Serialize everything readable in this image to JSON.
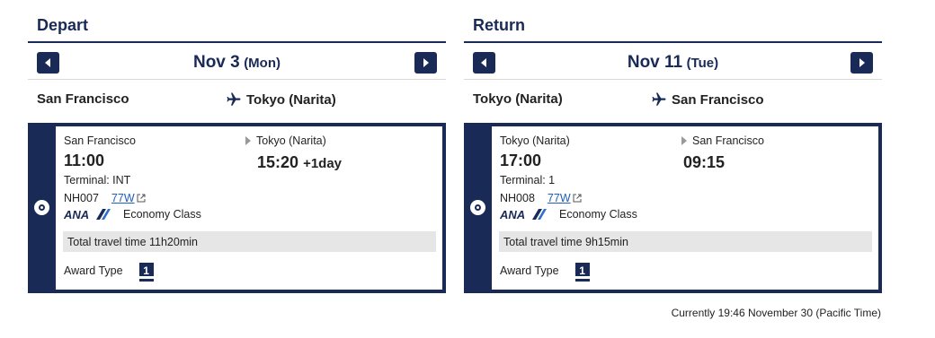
{
  "depart": {
    "title": "Depart",
    "date_main": "Nov 3",
    "date_day": "(Mon)",
    "route_from": "San Francisco",
    "route_to": "Tokyo (Narita)",
    "flight": {
      "from_city": "San Francisco",
      "from_time": "11:00",
      "terminal": "Terminal: INT",
      "flight_number": "NH007",
      "aircraft": "77W",
      "airline_logo": "ANA",
      "cabin": "Economy Class",
      "to_city": "Tokyo (Narita)",
      "to_time": "15:20",
      "plus_day": "+1day",
      "travel_time": "Total travel time 11h20min",
      "award_label": "Award Type",
      "award_value": "1"
    }
  },
  "return": {
    "title": "Return",
    "date_main": "Nov 11",
    "date_day": "(Tue)",
    "route_from": "Tokyo (Narita)",
    "route_to": "San Francisco",
    "flight": {
      "from_city": "Tokyo (Narita)",
      "from_time": "17:00",
      "terminal": "Terminal: 1",
      "flight_number": "NH008",
      "aircraft": "77W",
      "airline_logo": "ANA",
      "cabin": "Economy Class",
      "to_city": "San Francisco",
      "to_time": "09:15",
      "plus_day": "",
      "travel_time": "Total travel time 9h15min",
      "award_label": "Award Type",
      "award_value": "1"
    }
  },
  "footer": {
    "current_time": "Currently 19:46 November 30 (Pacific Time)"
  },
  "colors": {
    "navy": "#1a2a57",
    "link": "#1f5fb8",
    "panel": "#e6e6e6"
  }
}
